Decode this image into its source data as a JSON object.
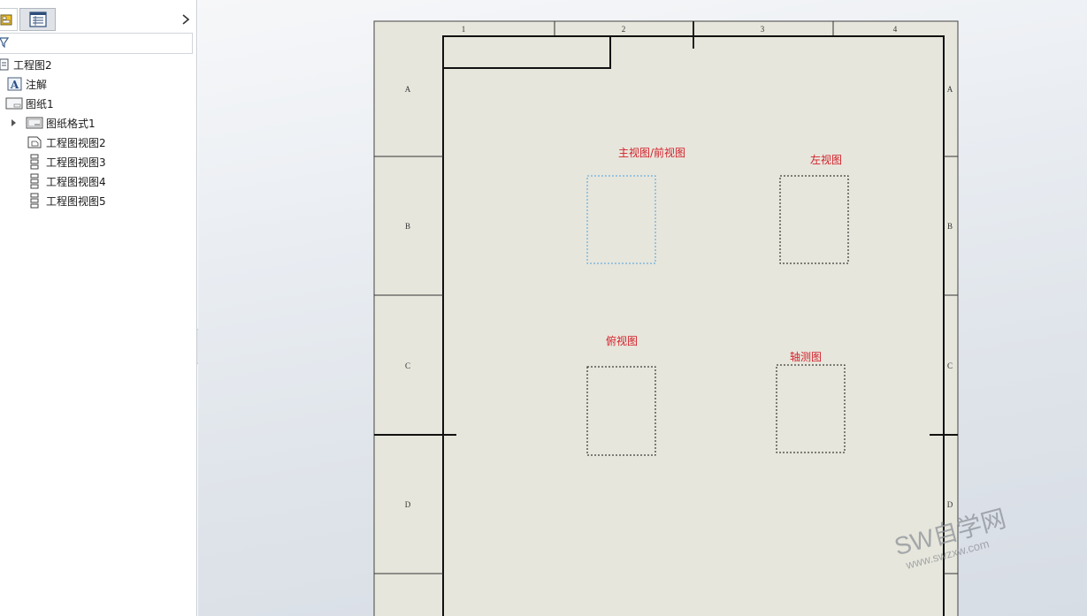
{
  "feature_tree": {
    "root": {
      "label": "工程图2",
      "icon": "drawing-doc-icon"
    },
    "items": [
      {
        "label": "注解",
        "icon": "annotation-folder-icon"
      },
      {
        "label": "图纸1",
        "icon": "sheet-icon"
      },
      {
        "label": "图纸格式1",
        "icon": "sheet-format-icon"
      },
      {
        "label": "工程图视图2",
        "icon": "drawing-view-icon"
      },
      {
        "label": "工程图视图3",
        "icon": "drawing-view-icon"
      },
      {
        "label": "工程图视图4",
        "icon": "drawing-view-icon"
      },
      {
        "label": "工程图视图5",
        "icon": "drawing-view-icon"
      }
    ]
  },
  "sheet": {
    "column_labels": [
      "1",
      "2",
      "3",
      "4"
    ],
    "row_labels": [
      "A",
      "B",
      "C",
      "D"
    ],
    "views": [
      {
        "label": "主视图/前视图",
        "state": "selected"
      },
      {
        "label": "左视图",
        "state": "normal"
      },
      {
        "label": "俯视图",
        "state": "normal"
      },
      {
        "label": "轴测图",
        "state": "normal"
      }
    ],
    "paper_color": "#e7e6dc",
    "selected_color": "#4aa3e0"
  },
  "watermark": {
    "main": "SW自学网",
    "sub": "www.swzxw.com"
  }
}
